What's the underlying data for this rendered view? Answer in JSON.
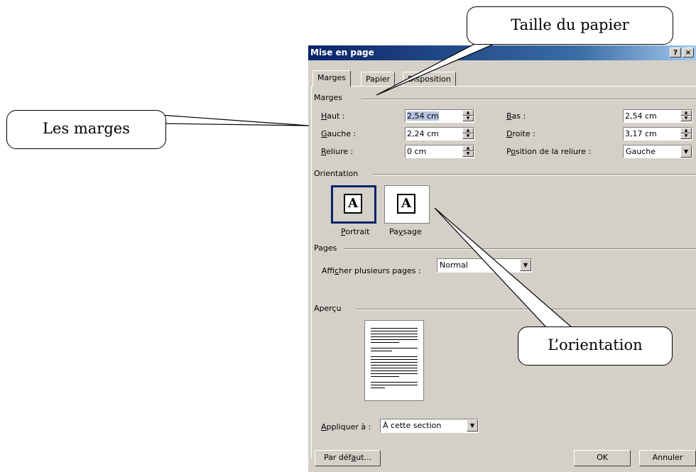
{
  "dialog": {
    "title": "Mise en page",
    "help_button": "?",
    "close_button": "×",
    "tabs": [
      {
        "label": "Marges",
        "active": true
      },
      {
        "label": "Papier",
        "active": false
      },
      {
        "label": "Disposition",
        "active": false
      }
    ],
    "margins": {
      "heading": "Marges",
      "top_label": "Haut :",
      "top_label_u": "H",
      "top_label_rest": "aut :",
      "top_value": "2,54 cm",
      "bottom_label_u": "B",
      "bottom_label_rest": "as :",
      "bottom_value": "2,54 cm",
      "left_label_u": "G",
      "left_label_rest": "auche :",
      "left_value": "2,24 cm",
      "right_label_u": "D",
      "right_label_rest": "roite :",
      "right_value": "3,17 cm",
      "gutter_label_u": "R",
      "gutter_label_rest": "eliure :",
      "gutter_value": "0 cm",
      "gutter_pos_label_pre": "P",
      "gutter_pos_label_u": "o",
      "gutter_pos_label_rest": "sition de la reliure :",
      "gutter_pos_value": "Gauche"
    },
    "orientation": {
      "heading": "Orientation",
      "glyph": "A",
      "portrait_label_u": "P",
      "portrait_label_rest": "ortrait",
      "landscape_label_pre": "Pa",
      "landscape_label_u": "y",
      "landscape_label_rest": "sage",
      "selected": "portrait"
    },
    "pages": {
      "heading": "Pages",
      "multi_label_pre": "Affi",
      "multi_label_u": "c",
      "multi_label_rest": "her plusieurs pages :",
      "multi_value": "Normal"
    },
    "preview": {
      "heading": "Aperçu",
      "apply_label_u": "A",
      "apply_label_rest": "ppliquer à :",
      "apply_value": "À cette section"
    },
    "buttons": {
      "default_pre": "Par déf",
      "default_u": "a",
      "default_rest": "ut...",
      "ok": "OK",
      "cancel": "Annuler"
    }
  },
  "callouts": {
    "paper_size": "Taille du papier",
    "margins": "Les marges",
    "orientation": "L’orientation"
  },
  "colors": {
    "dialog_bg": "#d4d0c8",
    "titlebar": "#0a246a",
    "selection": "#b6c4e0"
  }
}
